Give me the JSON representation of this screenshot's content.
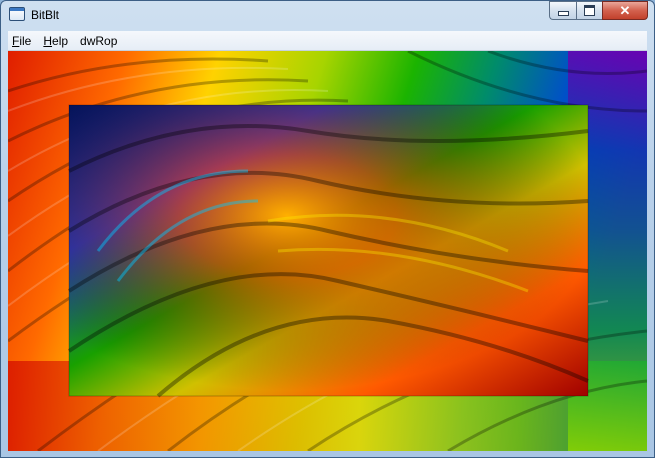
{
  "window": {
    "title": "BitBlt"
  },
  "menubar": {
    "items": [
      {
        "label": "File",
        "accel": "F",
        "rest": "ile"
      },
      {
        "label": "Help",
        "accel": "H",
        "rest": "elp"
      },
      {
        "label": "dwRop",
        "accel": "",
        "rest": "dwRop"
      }
    ]
  },
  "caption_buttons": {
    "close_glyph": "✕"
  },
  "colors": {
    "titlebar": "#b9d1ea",
    "menubar": "#eef3f9",
    "close": "#c2412c"
  }
}
